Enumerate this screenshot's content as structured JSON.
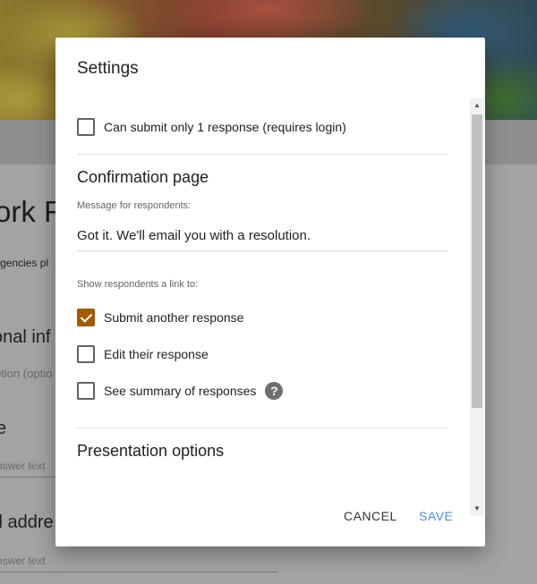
{
  "background": {
    "title_fragment": "ork R",
    "subtitle_fragment": "rgencies pl",
    "section_fragment": "onal inf",
    "option_fragment": "ption (optio",
    "question1_fragment": "e",
    "answer1_placeholder": "nswer text",
    "question2_fragment": "il addre",
    "answer2_placeholder": "nswer text"
  },
  "dialog": {
    "title": "Settings",
    "submit_once_label": "Can submit only 1 response (requires login)",
    "submit_once_checked": false,
    "confirmation": {
      "heading": "Confirmation page",
      "message_label": "Message for respondents:",
      "message_value": "Got it. We'll email you with a resolution."
    },
    "links": {
      "heading": "Show respondents a link to:",
      "items": [
        {
          "label": "Submit another response",
          "checked": true
        },
        {
          "label": "Edit their response",
          "checked": false
        },
        {
          "label": "See summary of responses",
          "checked": false
        }
      ],
      "help_icon": "?"
    },
    "presentation_heading": "Presentation options",
    "buttons": {
      "cancel": "CANCEL",
      "save": "SAVE"
    }
  },
  "colors": {
    "checkbox_checked": "#a25a05",
    "save_button": "#4a90e2"
  }
}
